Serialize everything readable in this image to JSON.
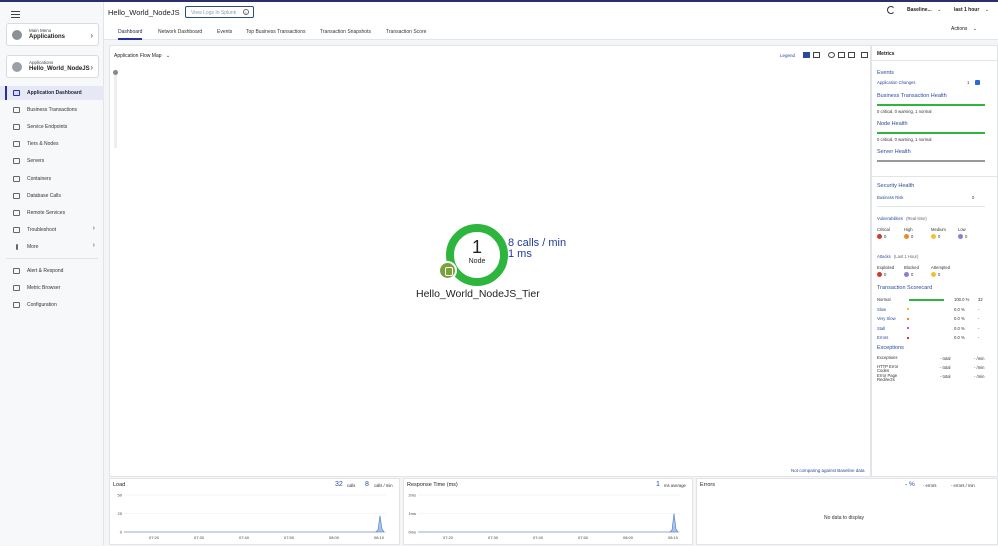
{
  "header": {
    "title": "Hello_World_NodeJS",
    "splunk_button": "View Logs In Splunk",
    "baseline": "Baseline...",
    "time_range": "last 1 hour",
    "actions": "Actions",
    "tabs": [
      "Dashboard",
      "Network Dashboard",
      "Events",
      "Top Business Transactions",
      "Transaction Snapshots",
      "Transaction Score"
    ]
  },
  "sidebar": {
    "main_menu_small": "Main Menu",
    "main_menu_big": "Applications",
    "app_small": "Applications",
    "app_big": "Hello_World_NodeJS",
    "items": [
      {
        "label": "Application Dashboard"
      },
      {
        "label": "Business Transactions"
      },
      {
        "label": "Service Endpoints"
      },
      {
        "label": "Tiers & Nodes"
      },
      {
        "label": "Servers"
      },
      {
        "label": "Containers"
      },
      {
        "label": "Database Calls"
      },
      {
        "label": "Remote Services"
      },
      {
        "label": "Troubleshoot"
      },
      {
        "label": "More"
      },
      {
        "label": "Alert & Respond"
      },
      {
        "label": "Metric Browser"
      },
      {
        "label": "Configuration"
      }
    ]
  },
  "flowmap": {
    "title": "Application Flow Map",
    "legend": "Legend",
    "node_count": "1",
    "node_word": "Node",
    "calls": "8 calls / min",
    "response": "1 ms",
    "tier_name": "Hello_World_NodeJS_Tier",
    "baseline_note": "Not comparing against Baseline data"
  },
  "metrics": {
    "header": "Metrics",
    "events": "Events",
    "application_changes": "Application Changes",
    "application_changes_count": "1",
    "bt_health": "Business Transaction Health",
    "bt_health_summary": "0 critical, 0 warning, 1 normal",
    "node_health": "Node Health",
    "node_health_summary": "0 critical, 0 warning, 1 normal",
    "server_health": "Server Health",
    "security_health": "Security Health",
    "business_risk": "Business Risk",
    "business_risk_value": "0",
    "vulnerabilities": "Vulnerabilities",
    "vulnerabilities_note": "(Real-time)",
    "vuln_levels": [
      {
        "label": "Critical",
        "value": "0",
        "color": "#d33a2c"
      },
      {
        "label": "High",
        "value": "0",
        "color": "#f08a24"
      },
      {
        "label": "Medium",
        "value": "0",
        "color": "#f2c12e"
      },
      {
        "label": "Low",
        "value": "0",
        "color": "#8a7fd8"
      }
    ],
    "attacks": "Attacks",
    "attacks_note": "(Last 1 Hour)",
    "attack_levels": [
      {
        "label": "Exploited",
        "value": "0",
        "color": "#d33a2c"
      },
      {
        "label": "Blocked",
        "value": "0",
        "color": "#8a7fd8"
      },
      {
        "label": "Attempted",
        "value": "0",
        "color": "#f2c12e"
      }
    ],
    "scorecard_title": "Transaction Scorecard",
    "scorecard": [
      {
        "label": "Normal",
        "pct": "100.0 %",
        "count": "32",
        "color": "#2db53d",
        "fill": 1.0
      },
      {
        "label": "Slow",
        "pct": "0.0 %",
        "count": "-",
        "color": "#f2c12e",
        "fill": 0
      },
      {
        "label": "Very Slow",
        "pct": "0.0 %",
        "count": "-",
        "color": "#f08a24",
        "fill": 0
      },
      {
        "label": "Stall",
        "pct": "0.0 %",
        "count": "-",
        "color": "#b75dc9",
        "fill": 0
      },
      {
        "label": "Errors",
        "pct": "0.0 %",
        "count": "-",
        "color": "#d33a2c",
        "fill": 0
      }
    ],
    "exceptions_title": "Exceptions",
    "exceptions": [
      {
        "label": "Exceptions",
        "total": "- total",
        "rate": "- /min"
      },
      {
        "label": "HTTP Error Codes",
        "total": "- total",
        "rate": "- /min"
      },
      {
        "label": "Error Page Redirects",
        "total": "- total",
        "rate": "- /min"
      }
    ]
  },
  "bottom": {
    "load": {
      "title": "Load",
      "calls": "32",
      "calls_unit": "calls",
      "rate": "8",
      "rate_unit": "calls / min"
    },
    "response": {
      "title": "Response Time (ms)",
      "value": "1",
      "unit": "ms average"
    },
    "errors": {
      "title": "Errors",
      "pct": "- %",
      "errors": "- errors",
      "rate": "- errors / min",
      "empty": "No data to display"
    }
  },
  "chart_data": [
    {
      "type": "area",
      "title": "Load",
      "x": [
        "07:20",
        "07:30",
        "07:40",
        "07:50",
        "08:00",
        "08:10"
      ],
      "yticks": [
        "50",
        "25",
        "0"
      ],
      "ylim": [
        0,
        50
      ],
      "series": [
        {
          "values": [
            0,
            0,
            0,
            0,
            0,
            22
          ]
        }
      ]
    },
    {
      "type": "area",
      "title": "Response Time (ms)",
      "x": [
        "07:20",
        "07:30",
        "07:40",
        "07:50",
        "08:00",
        "08:10"
      ],
      "yticks": [
        "2ms",
        "1ms",
        "0ms"
      ],
      "ylim": [
        0,
        2
      ],
      "series": [
        {
          "values": [
            0,
            0,
            0,
            0,
            0,
            1
          ]
        }
      ]
    }
  ]
}
